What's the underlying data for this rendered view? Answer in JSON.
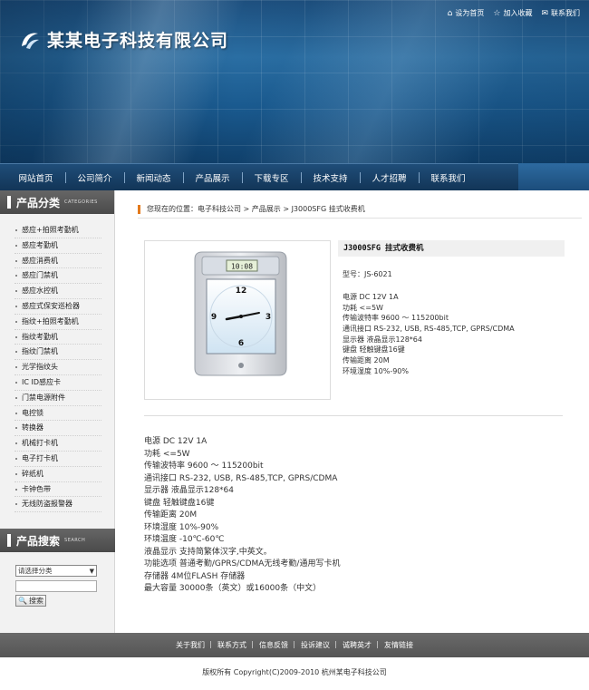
{
  "top_links": [
    {
      "label": "设为首页",
      "icon": "home-icon"
    },
    {
      "label": "加入收藏",
      "icon": "star-icon"
    },
    {
      "label": "联系我们",
      "icon": "mail-icon"
    }
  ],
  "brand": {
    "name": "某某电子科技有限公司"
  },
  "nav": [
    "网站首页",
    "公司简介",
    "新闻动态",
    "产品展示",
    "下载专区",
    "技术支持",
    "人才招聘",
    "联系我们"
  ],
  "sidebar": {
    "categories_title": "产品分类",
    "categories_en": "CATEGORIES",
    "categories": [
      "感应+拍照考勤机",
      "感应考勤机",
      "感应消费机",
      "感应门禁机",
      "感应水控机",
      "感应式保安巡检器",
      "指纹+拍照考勤机",
      "指纹考勤机",
      "指纹门禁机",
      "光学指纹头",
      "IC ID感应卡",
      "门禁电源附件",
      "电控锁",
      "转换器",
      "机械打卡机",
      "电子打卡机",
      "碎纸机",
      "卡钟色带",
      "无线防盗报警器"
    ],
    "search_title": "产品搜索",
    "search_en": "SEARCH",
    "select_value": "请选择分类",
    "search_button": "搜索"
  },
  "breadcrumb": "您现在的位置：电子科技公司 > 产品展示 > J3000SFG 挂式收费机",
  "product": {
    "title": "J3000SFG 挂式收费机",
    "model": "型号：JS-6021",
    "short_specs": [
      "电源 DC 12V 1A",
      "功耗 <=5W",
      "传输波特率 9600 ～ 115200bit",
      "通讯接口 RS-232, USB, RS-485,TCP, GPRS/CDMA",
      "显示器 液晶显示128*64",
      "键盘 轻触键盘16键",
      "传输距离 20M",
      "环境湿度 10%-90%"
    ],
    "long_specs": [
      "电源 DC 12V 1A",
      "功耗 <=5W",
      "传输波特率 9600 ～ 115200bit",
      "通讯接口 RS-232, USB, RS-485,TCP, GPRS/CDMA",
      "显示器 液晶显示128*64",
      "键盘 轻触键盘16键",
      "传输距离 20M",
      "环境湿度 10%-90%",
      "环境温度 -10℃-60℃",
      "液晶显示 支持简繁体汉字,中英文。",
      "功能选项 普通考勤/GPRS/CDMA无线考勤/通用写卡机",
      "存储器 4M位FLASH 存储器",
      "最大容量 30000条（英文）或16000条（中文）"
    ],
    "device_screen": "10:08"
  },
  "footer": {
    "links": [
      "关于我们",
      "联系方式",
      "信息反馈",
      "投诉建议",
      "诚聘英才",
      "友情链接"
    ],
    "copyright": "版权所有 Copyright(C)2009-2010 杭州某电子科技公司"
  }
}
